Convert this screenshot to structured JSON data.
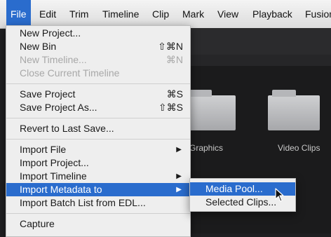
{
  "menubar": {
    "items": [
      "File",
      "Edit",
      "Trim",
      "Timeline",
      "Clip",
      "Mark",
      "View",
      "Playback",
      "Fusion"
    ]
  },
  "file_menu": {
    "items": [
      {
        "label": "New Project...",
        "shortcut": "",
        "enabled": true
      },
      {
        "label": "New Bin",
        "shortcut": "⇧⌘N",
        "enabled": true
      },
      {
        "label": "New Timeline...",
        "shortcut": "⌘N",
        "enabled": false
      },
      {
        "label": "Close Current Timeline",
        "shortcut": "",
        "enabled": false
      },
      {
        "label": "Save Project",
        "shortcut": "⌘S",
        "enabled": true
      },
      {
        "label": "Save Project As...",
        "shortcut": "⇧⌘S",
        "enabled": true
      },
      {
        "label": "Revert to Last Save...",
        "shortcut": "",
        "enabled": true
      },
      {
        "label": "Import File",
        "submenu": true,
        "enabled": true
      },
      {
        "label": "Import Project...",
        "enabled": true
      },
      {
        "label": "Import Timeline",
        "submenu": true,
        "enabled": true
      },
      {
        "label": "Import Metadata to",
        "submenu": true,
        "enabled": true,
        "highlighted": true
      },
      {
        "label": "Import Batch List from EDL...",
        "enabled": true
      },
      {
        "label": "Capture",
        "enabled": true
      }
    ]
  },
  "submenu": {
    "items": [
      {
        "label": "Media Pool...",
        "highlighted": true
      },
      {
        "label": "Selected Clips..."
      }
    ]
  },
  "media_pool": {
    "folders": [
      "Graphics",
      "Video Clips"
    ]
  },
  "colors": {
    "highlight": "#2a6ccd",
    "menu_bg": "#eeeeee",
    "app_bg": "#1f1f21"
  },
  "icons": {
    "submenu_arrow": "triangle-right-icon",
    "cursor": "pointer-cursor-icon"
  }
}
